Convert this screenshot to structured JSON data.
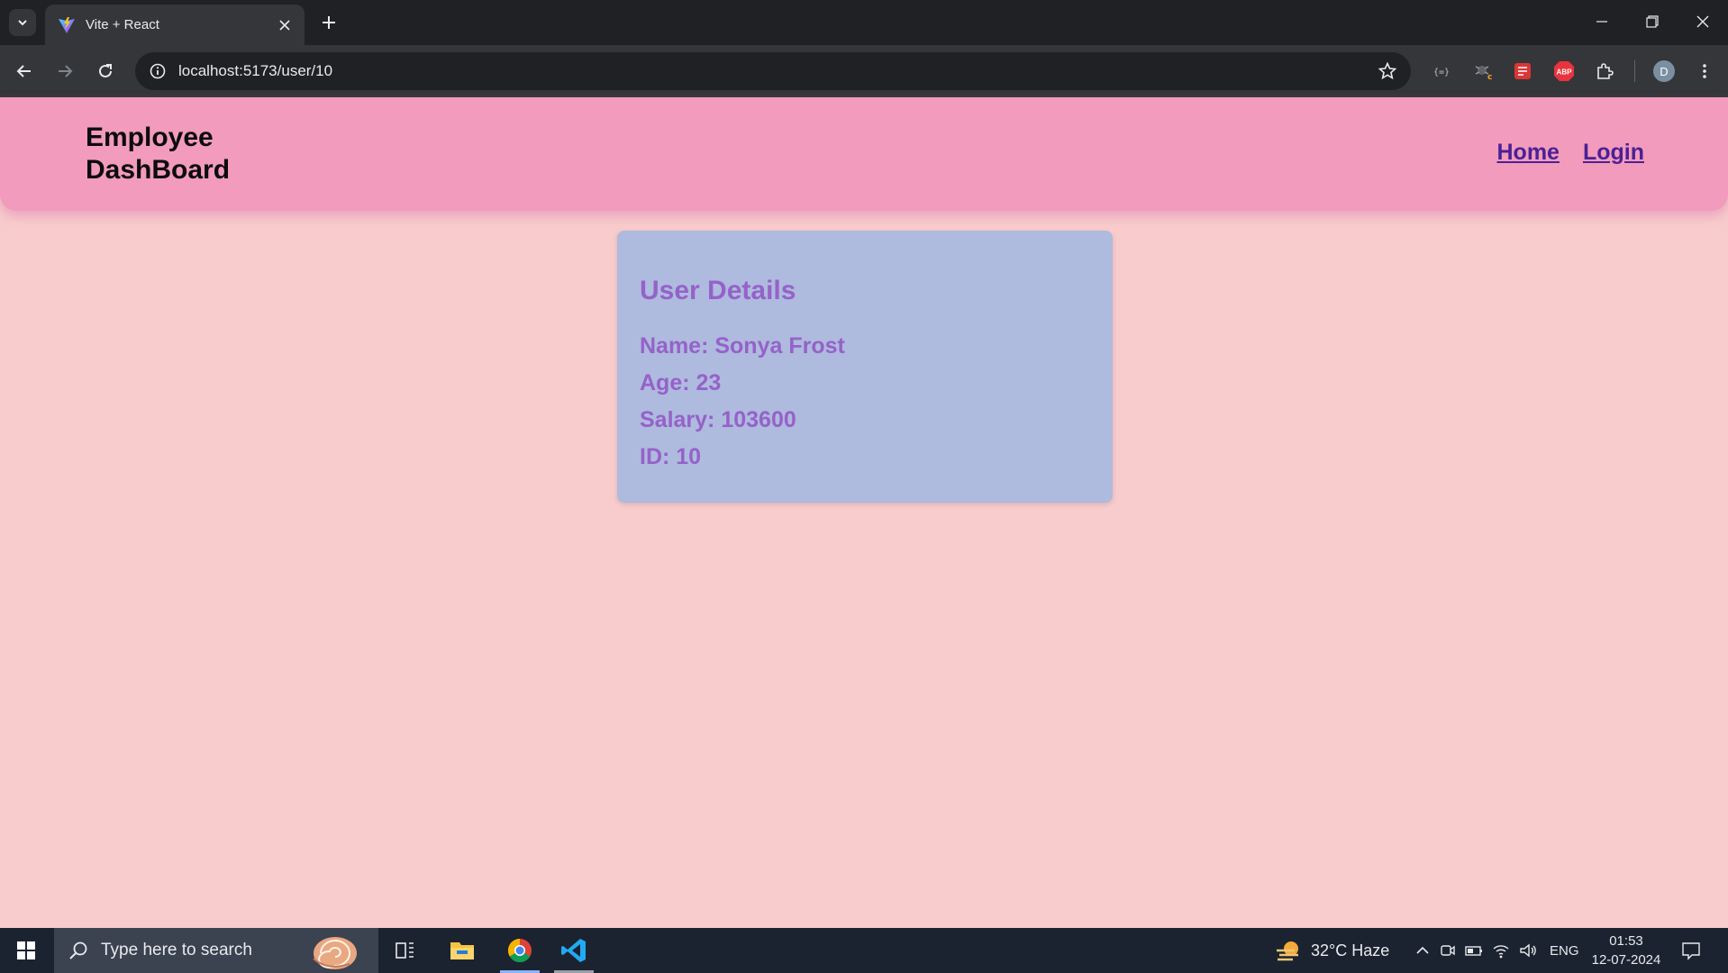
{
  "browser": {
    "tab_title": "Vite + React",
    "url": "localhost:5173/user/10",
    "profile_initial": "D",
    "extensions": [
      "json-icon",
      "bug-c-icon",
      "red-extension-icon",
      "ABP",
      "puzzle-icon"
    ]
  },
  "header": {
    "brand_line1": "Employee",
    "brand_line2": "DashBoard",
    "nav": {
      "home": "Home",
      "login": "Login"
    }
  },
  "card": {
    "title": "User Details",
    "name": "Name: Sonya Frost",
    "age": "Age: 23",
    "salary": "Salary: 103600",
    "id": "ID: 10"
  },
  "taskbar": {
    "search_placeholder": "Type here to search",
    "weather": "32°C  Haze",
    "language": "ENG",
    "time": "01:53",
    "date": "12-07-2024"
  },
  "colors": {
    "page_bg": "#f8cbcc",
    "header_bg": "#f29bbc",
    "card_bg": "#aebade",
    "card_text": "#9562c9",
    "nav_link": "#4a2195"
  }
}
